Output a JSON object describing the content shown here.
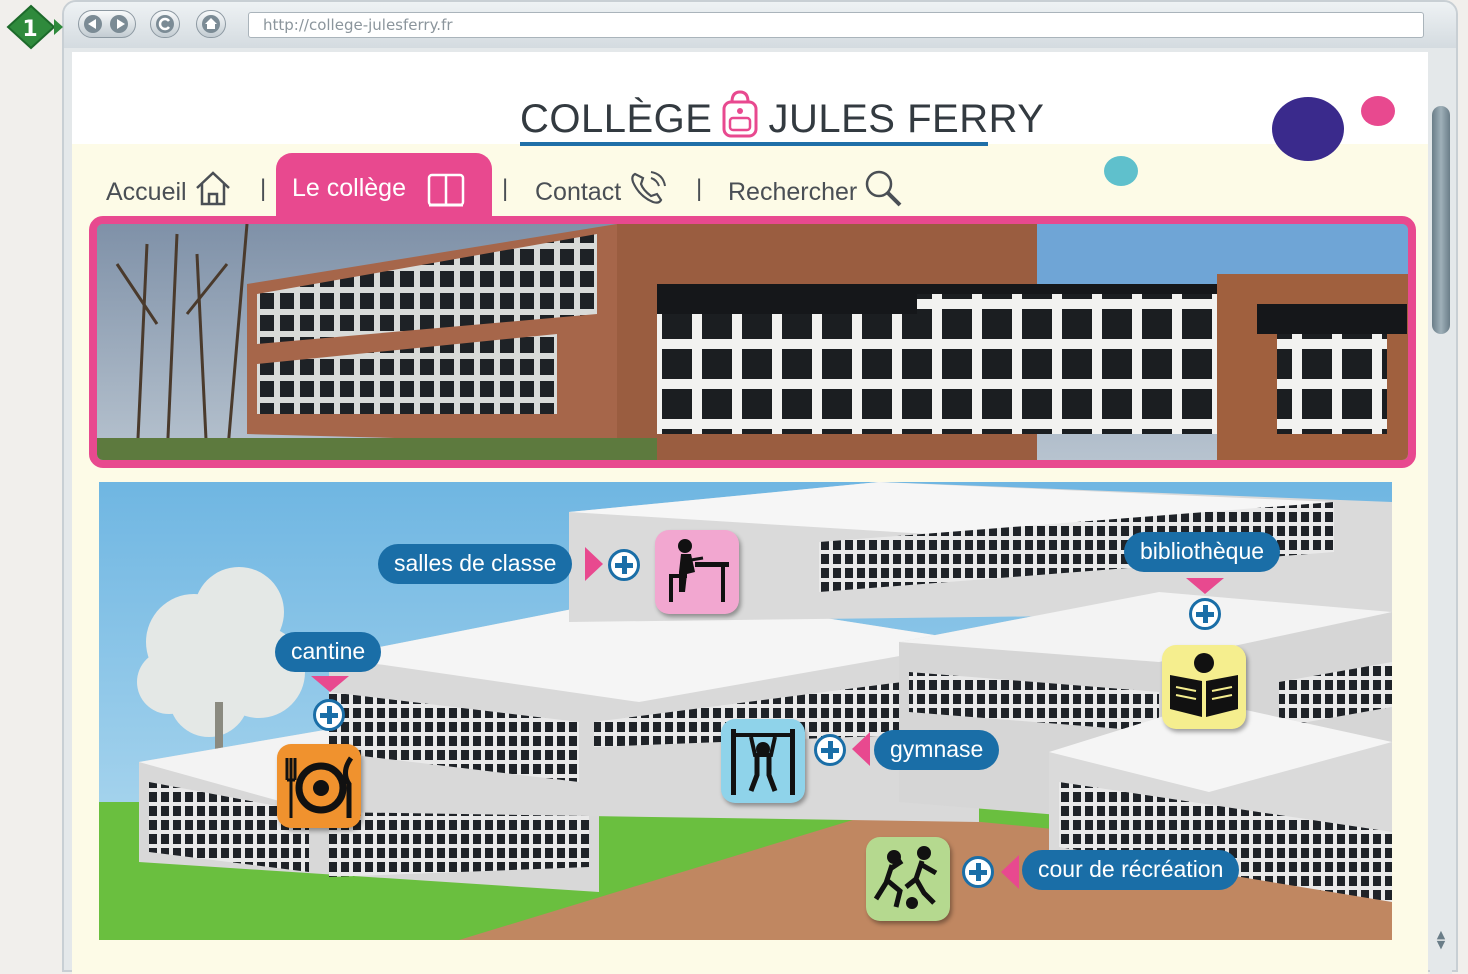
{
  "step_badge": "1",
  "browser": {
    "url": "http://college-julesferry.fr",
    "back_icon": "back-arrow-icon",
    "forward_icon": "forward-arrow-icon",
    "reload_icon": "reload-icon",
    "home_icon": "home-icon"
  },
  "site": {
    "title_part1": "COLLÈGE",
    "title_part2": "JULES FERRY",
    "logo_icon": "backpack-icon"
  },
  "menu": {
    "items": [
      {
        "label": "Accueil",
        "icon": "house-icon"
      },
      {
        "label": "Le collège",
        "icon": "book-icon",
        "active": true
      },
      {
        "label": "Contact",
        "icon": "phone-icon"
      },
      {
        "label": "Rechercher",
        "icon": "magnifier-icon"
      }
    ],
    "separator": "|"
  },
  "hotspots": [
    {
      "label": "salles de classe",
      "icon": "student-at-desk-icon",
      "color": "#f2a7d0"
    },
    {
      "label": "bibliothèque",
      "icon": "reading-book-icon",
      "color": "#f5ee8e"
    },
    {
      "label": "cantine",
      "icon": "plate-and-cutlery-icon",
      "color": "#f0922e"
    },
    {
      "label": "gymnase",
      "icon": "pull-up-bar-icon",
      "color": "#8fd3ea"
    },
    {
      "label": "cour de récréation",
      "icon": "playing-children-icon",
      "color": "#b5d98f"
    }
  ],
  "colors": {
    "accent_pink": "#e8498f",
    "label_blue": "#1a6ea7",
    "title_underline": "#1f6fa8",
    "deco_purple": "#3a2a8c",
    "deco_teal": "#5fc0cc"
  }
}
